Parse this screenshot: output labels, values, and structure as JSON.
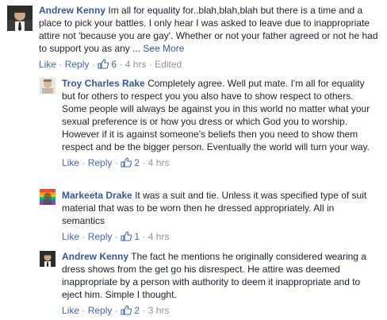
{
  "comments": [
    {
      "author": "Andrew Kenny",
      "text": "Im all for equality for..blah,blah,blah but there is a time and a place to pick your battles. I only hear I was asked to leave due to inappropriate attire not 'because you are gay'. Whether or not your father agreed or not he had to support you as any ...",
      "see_more": "See More",
      "like": "Like",
      "reply": "Reply",
      "reactions": "6",
      "time": "4 hrs",
      "edited": "Edited",
      "sep": "·",
      "avatar_icon": "person-avatar-icon"
    }
  ],
  "replies": [
    {
      "author": "Troy Charles Rake",
      "text": "Completely agree. Well put mate. I'm all for equality but for others to respect you you also have to show respect to others. Some people will always be against you in this world no matter what your sexual preference is or how you dress or which God you to worship. However if it is against someone's beliefs then you need to show them respect and be the bigger person. Eventually the world will turn your way.",
      "like": "Like",
      "reply": "Reply",
      "reactions": "2",
      "time": "4 hrs",
      "sep": "·"
    },
    {
      "author": "Markeeta Drake",
      "text": "It was a suit and tie. Unless it was specified type of suit material that was to be worn then he dressed appropriately. All in semantics",
      "like": "Like",
      "reply": "Reply",
      "reactions": "1",
      "time": "4 hrs",
      "sep": "·"
    },
    {
      "author": "Andrew Kenny",
      "text": "The fact he mentions he originally considered wearing a dress shows from the get go his disrespect. He attire was deemed inappropriate by a person with authority to deem it inappropriate and to eject him. Simple I thought.",
      "like": "Like",
      "reply": "Reply",
      "reactions": "2",
      "time": "3 hrs",
      "sep": "·"
    }
  ],
  "colors": {
    "author": "#365899",
    "link": "#4267b2",
    "meta": "#90949c",
    "text": "#1d2129"
  }
}
